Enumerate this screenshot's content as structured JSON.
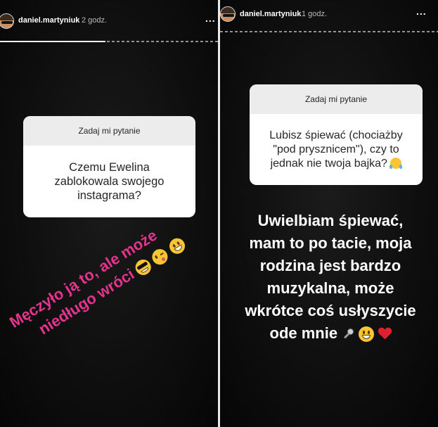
{
  "stories": [
    {
      "username": "daniel.martyniuk",
      "time": "2 godz.",
      "more_label": "...",
      "question_header": "Zadaj mi pytanie",
      "question_text": "Czemu Ewelina zablokowala swojego instagrama?",
      "answer_lines": [
        "Męczyło ją to, ale może",
        "niedługo wróci"
      ],
      "answer_color": "#e6338e",
      "answer_emoji": [
        "sunglasses-emoji",
        "wink-tongue-emoji",
        "grinning-emoji"
      ]
    },
    {
      "username": "daniel.martyniuk",
      "time": "1 godz.",
      "more_label": "...",
      "question_header": "Zadaj mi pytanie",
      "question_text": "Lubisz śpiewać (chociażby \"pod prysznicem\"), czy to jednak nie twoja bajka?",
      "question_emoji": "tears-of-joy-emoji",
      "answer_lines": [
        "Uwielbiam śpiewać,",
        "mam to po tacie, moja",
        "rodzina jest bardzo",
        "muzykalna, może",
        "wkrótce coś usłyszycie",
        "ode mnie"
      ],
      "answer_color": "#ffffff",
      "answer_emoji": [
        "microphone-emoji",
        "grinning-emoji",
        "red-heart-emoji"
      ]
    }
  ]
}
